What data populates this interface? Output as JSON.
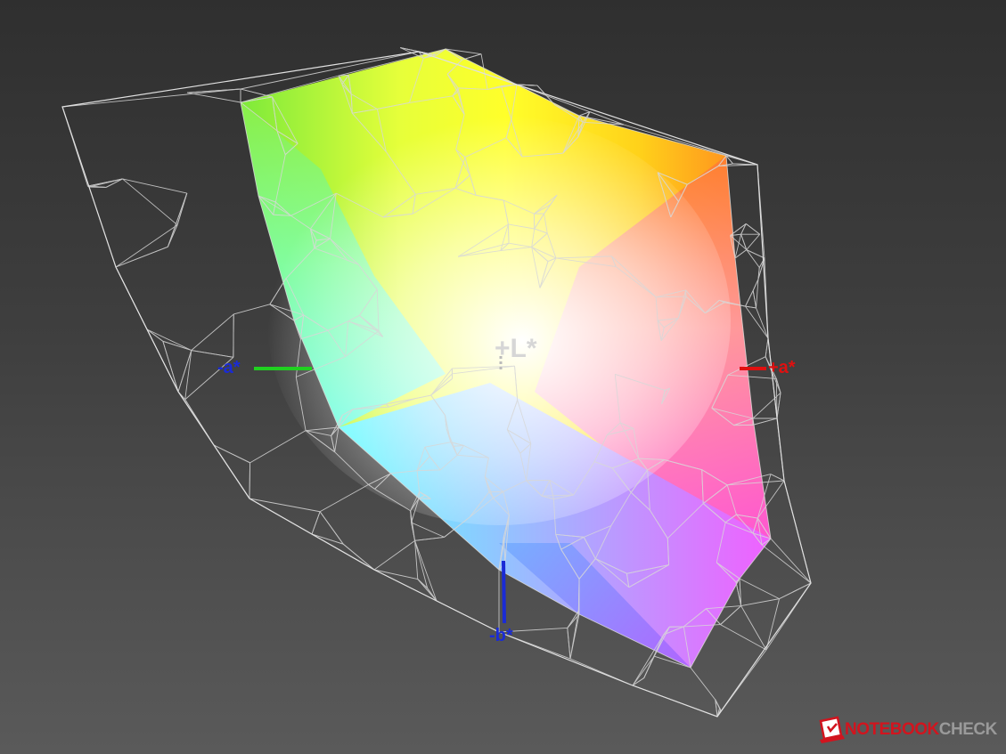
{
  "axes": {
    "plus_L": "+L*",
    "plus_a": "+a*",
    "minus_a": "-a*",
    "minus_b": "-b*"
  },
  "logo": {
    "part1": "NOTEBOOK",
    "part2": "CHECK"
  },
  "colors": {
    "background_top": "#2f2f2f",
    "background_bottom": "#5a5a5a",
    "wireframe": "#d8d8d8",
    "axis_a_positive": "#e01010",
    "axis_a_negative": "#20d020",
    "axis_b_negative": "#1a2bd6",
    "brand_red": "#d2141e"
  }
}
